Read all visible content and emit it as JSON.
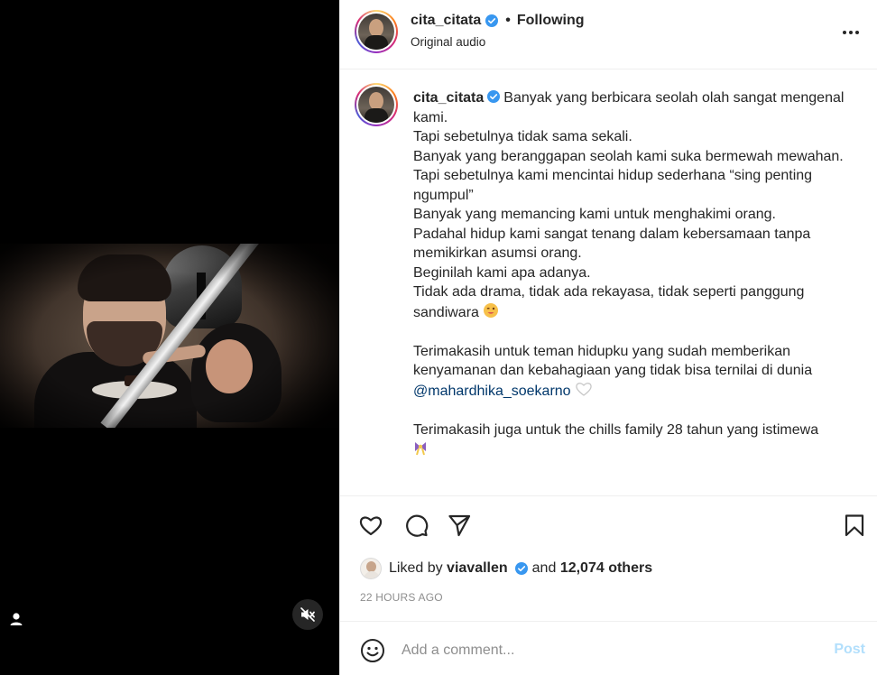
{
  "post": {
    "author": "cita_citata",
    "follow_status": "Following",
    "separator": "•",
    "audio_label": "Original audio"
  },
  "caption": {
    "author": "cita_citata",
    "text_main": "Banyak yang berbicara seolah olah sangat mengenal kami.\nTapi sebetulnya tidak sama sekali.\nBanyak yang beranggapan seolah kami suka bermewah mewahan.\nTapi sebetulnya kami mencintai hidup sederhana “sing penting ngumpul”\nBanyak yang memancing kami untuk menghakimi orang.\nPadahal hidup kami sangat tenang dalam kebersamaan tanpa memikirkan asumsi orang.\nBeginilah kami apa adanya.\nTidak ada drama, tidak ada rekayasa, tidak seperti panggung sandiwara ",
    "text_thanks": "\n\nTerimakasih untuk teman hidupku yang sudah memberikan kenyamanan dan kebahagiaan yang tidak bisa ternilai di dunia\n",
    "mention": "@mahardhika_soekarno",
    "text_family": "\n\nTerimakasih juga untuk the chills family 28 tahun yang istimewa\n",
    "emoji_wink": "wink-emoji",
    "emoji_heart": "white-heart-emoji",
    "emoji_ribbon": "ribbon-emoji"
  },
  "likes": {
    "prefix": "Liked by",
    "liker": "viavallen",
    "joiner": "and",
    "others": "12,074 others"
  },
  "timestamp": "22 HOURS AGO",
  "comment": {
    "placeholder": "Add a comment...",
    "post_label": "Post"
  },
  "colors": {
    "verified": "#3897f0",
    "link": "#00376b",
    "post_button_disabled": "#b2dffc",
    "muted_text": "#8e8e8e"
  },
  "icons": [
    "more-options-icon",
    "verified-badge-icon",
    "heart-icon",
    "comment-icon",
    "share-icon",
    "bookmark-icon",
    "emoji-icon",
    "user-tag-icon",
    "muted-speaker-icon"
  ]
}
